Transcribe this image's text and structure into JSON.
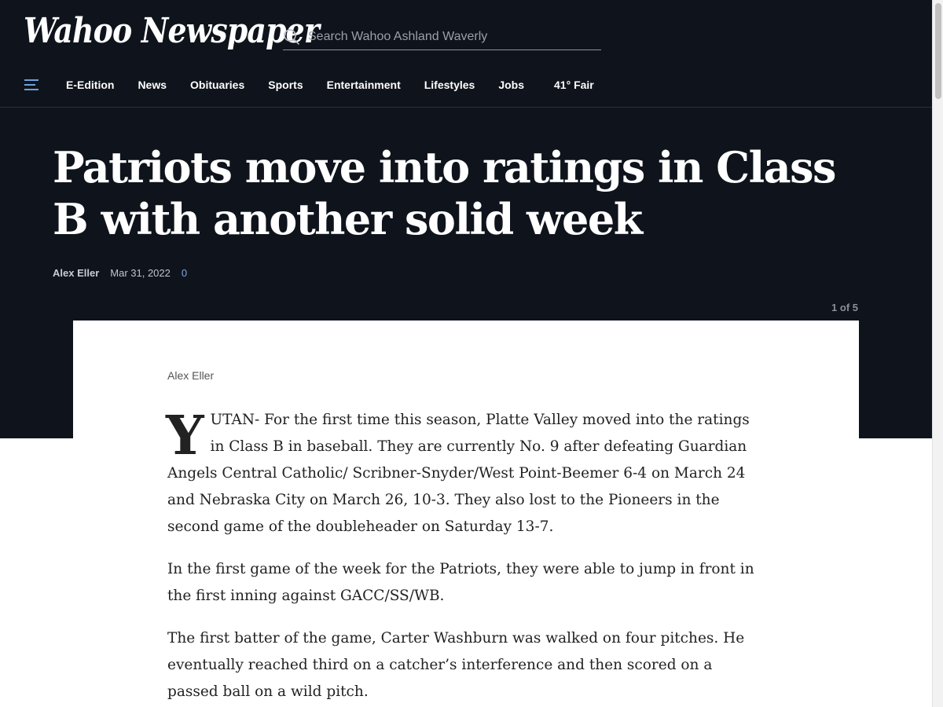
{
  "header": {
    "logo_text": "Wahoo Newspaper",
    "search_placeholder": "Search Wahoo Ashland Waverly"
  },
  "nav": {
    "items": [
      "E-Edition",
      "News",
      "Obituaries",
      "Sports",
      "Entertainment",
      "Lifestyles",
      "Jobs"
    ],
    "weather": "41° Fair"
  },
  "article": {
    "headline": "Patriots move into ratings in Class B with another solid week",
    "author": "Alex Eller",
    "date": "Mar 31, 2022",
    "comment_count": "0",
    "gallery_count": "1 of 5",
    "body_author": "Alex Eller",
    "drop_cap": "Y",
    "paragraphs": [
      "UTAN- For the first time this season, Platte Valley moved into the ratings in Class B in baseball. They are currently No. 9 after defeating Guardian Angels Central Catholic/ Scribner-Snyder/West Point-Beemer 6-4 on March 24 and Nebraska City on March 26, 10-3. They also lost to the Pioneers in the second game of the doubleheader on Saturday 13-7.",
      "In the first game of the week for the Patriots, they were able to jump in front in the first inning against GACC/SS/WB.",
      "The first batter of the game, Carter Washburn was walked on four pitches. He eventually reached third on a catcher’s interference and then scored on a passed ball on a wild pitch."
    ]
  },
  "colors": {
    "header_bg": "#0f141c",
    "comment_link": "#7aa7e0"
  }
}
